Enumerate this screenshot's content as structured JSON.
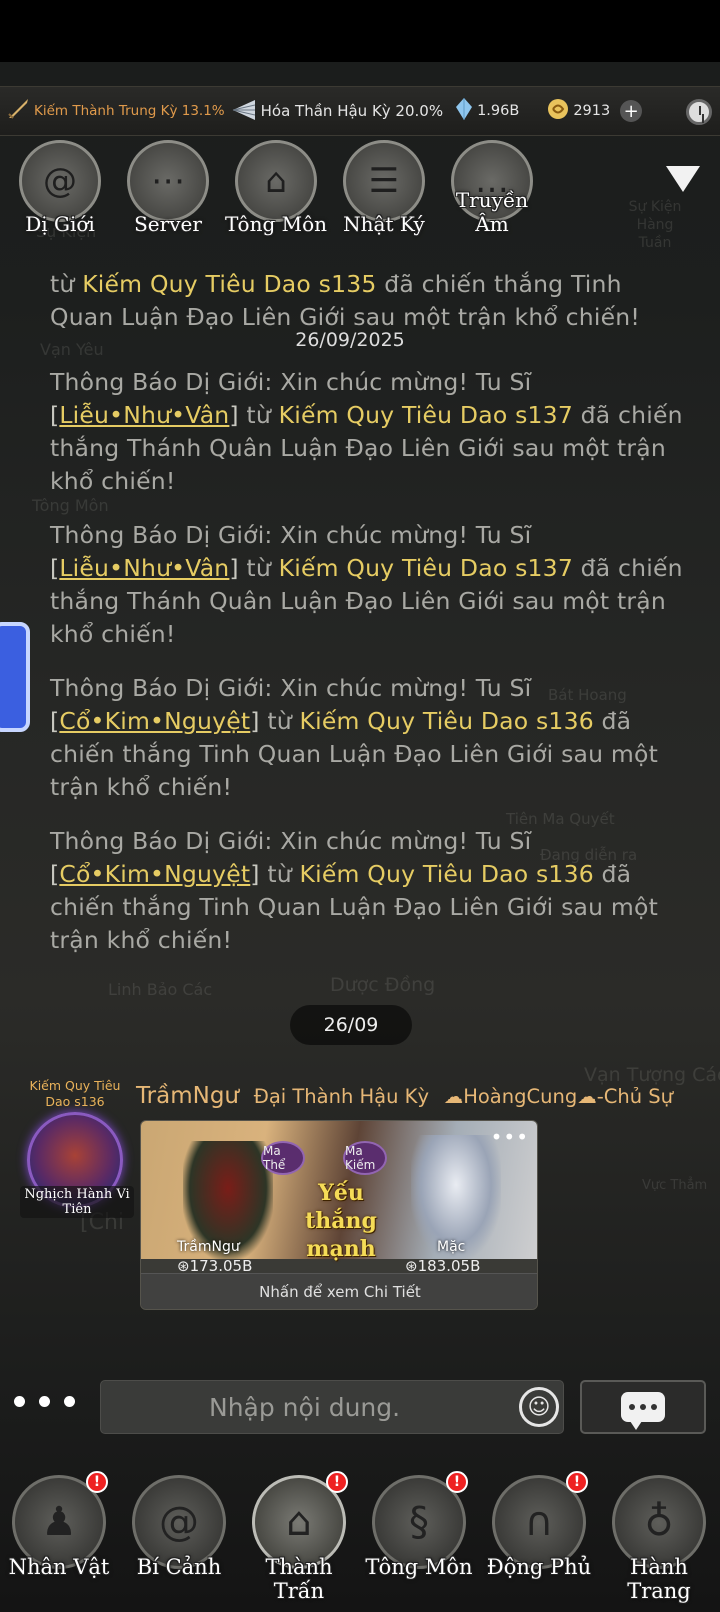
{
  "resources": {
    "cultivation": "Kiếm Thành Trung Kỳ 13.1%",
    "realm": "Hóa Thần Hậu Kỳ 20.0%",
    "crystals": "1.96B",
    "currency": "2913",
    "add_label": "+"
  },
  "channels": [
    {
      "label": "Dị Giới",
      "icon": "swirl-icon"
    },
    {
      "label": "Server",
      "icon": "network-icon"
    },
    {
      "label": "Tông Môn",
      "icon": "gate-icon"
    },
    {
      "label": "Nhật Ký",
      "icon": "journal-icon"
    },
    {
      "label": "Truyền Âm",
      "icon": "chat-icon"
    }
  ],
  "background": {
    "su_kien": "Sự Kiện",
    "su_kien_hang_tuan": "Sự Kiện Hàng Tuần",
    "van_yeu": "Vạn Yêu",
    "tong_mon": "Tông Môn",
    "linh_bao_cac": "Linh Bảo Các",
    "duoc_dong": "Dược Đồng",
    "tien_ma_quyet": "Tiên Ma Quyết",
    "van_tuong_cac": "Vạn Tượng Các",
    "vuc_tham": "Vực Thẳm",
    "bat_hoang": "Bát Hoang",
    "dang_dien_ra": "Đang diễn ra",
    "chien": "[Chi"
  },
  "messages": {
    "m0": {
      "pre": "từ ",
      "server": "Kiếm Quy Tiêu Dao s135",
      "post": " đã chiến thắng Tinh Quan Luận Đạo Liên Giới sau một trận khổ chiến!"
    },
    "date": "26/09/2025",
    "m1": {
      "pre": "Thông Báo Dị Giới: Xin chúc mừng! Tu Sĩ ",
      "name": "Liễu•Như•Vân",
      "mid": " từ ",
      "server": "Kiếm Quy Tiêu Dao s137",
      "post": " đã chiến thắng Thánh Quân Luận Đạo Liên Giới sau một trận khổ chiến!"
    },
    "m2": {
      "pre": "Thông Báo Dị Giới: Xin chúc mừng! Tu Sĩ ",
      "name": "Liễu•Như•Vân",
      "mid": " từ ",
      "server": "Kiếm Quy Tiêu Dao s137",
      "post": " đã chiến thắng Thánh Quân Luận Đạo Liên Giới sau một trận khổ chiến!"
    },
    "m3": {
      "pre": "Thông Báo Dị Giới: Xin chúc mừng! Tu Sĩ ",
      "name": "Cổ•Kim•Nguyệt",
      "mid": " từ ",
      "server": "Kiếm Quy Tiêu Dao s136",
      "post": " đã chiến thắng Tinh Quan Luận Đạo Liên Giới sau một trận khổ chiến!"
    },
    "m4": {
      "pre": "Thông Báo Dị Giới: Xin chúc mừng! Tu Sĩ ",
      "name": "Cổ•Kim•Nguyệt",
      "mid": " từ ",
      "server": "Kiếm Quy Tiêu Dao s136",
      "post": " đã chiến thắng Tinh Quan Luận Đạo Liên Giới sau một trận khổ chiến!"
    }
  },
  "date_pill": "26/09",
  "player": {
    "server": "Kiếm Quy Tiêu Dao s136",
    "title": "Nghịch Hành Vi Tiên",
    "name": "TrầmNgư",
    "rank": "Đại Thành Hậu Kỳ",
    "role": "☁HoàngCung☁-Chủ Sự"
  },
  "battle_card": {
    "badge_left": "Ma Thể",
    "badge_right": "Ma Kiếm",
    "result": "Yếu thắng mạnh",
    "left_name": "TrầmNgư",
    "left_power": "173.05B",
    "right_name": "Mặc",
    "right_power": "183.05B",
    "more": "•••",
    "footer": "Nhấn để xem Chi Tiết"
  },
  "input": {
    "placeholder": "Nhập nội dung."
  },
  "nav": [
    {
      "label": "Nhân Vật",
      "badge": "!"
    },
    {
      "label": "Bí Cảnh",
      "badge": ""
    },
    {
      "label": "Thành Trấn",
      "badge": "!"
    },
    {
      "label": "Tông Môn",
      "badge": "!"
    },
    {
      "label": "Động Phủ",
      "badge": "!"
    },
    {
      "label": "Hành Trang",
      "badge": ""
    }
  ],
  "colors": {
    "gold": "#e6cc63",
    "orange": "#e09a4b",
    "badge_red": "#e22222"
  }
}
